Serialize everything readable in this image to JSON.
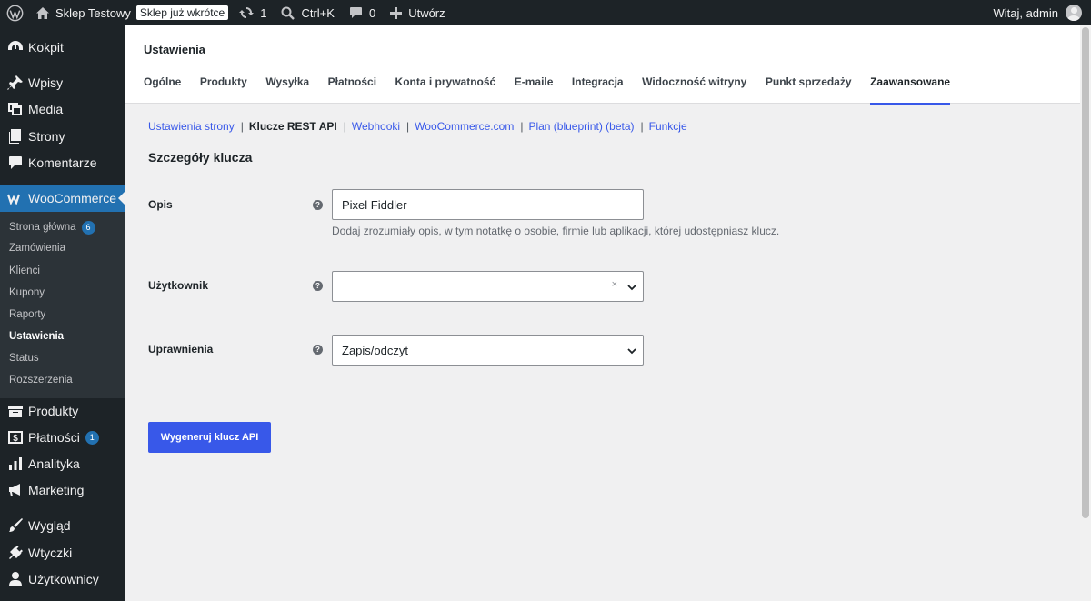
{
  "admin_bar": {
    "site_name": "Sklep Testowy",
    "coming_soon": "Sklep już wkrótce",
    "updates_count": "1",
    "search_shortcut": "Ctrl+K",
    "comments_count": "0",
    "new_label": "Utwórz",
    "greeting": "Witaj, admin"
  },
  "sidebar": {
    "items": [
      {
        "label": "Kokpit",
        "icon": "gauge-icon"
      },
      {
        "label": "Wpisy",
        "icon": "pushpin-icon"
      },
      {
        "label": "Media",
        "icon": "media-icon"
      },
      {
        "label": "Strony",
        "icon": "page-icon"
      },
      {
        "label": "Komentarze",
        "icon": "comment-icon"
      },
      {
        "label": "WooCommerce",
        "icon": "woocommerce-icon"
      },
      {
        "label": "Produkty",
        "icon": "archive-icon"
      },
      {
        "label": "Płatności",
        "icon": "payment-icon",
        "badge": "1"
      },
      {
        "label": "Analityka",
        "icon": "bar-chart-icon"
      },
      {
        "label": "Marketing",
        "icon": "megaphone-icon"
      },
      {
        "label": "Wygląd",
        "icon": "paintbrush-icon"
      },
      {
        "label": "Wtyczki",
        "icon": "plug-icon"
      },
      {
        "label": "Użytkownicy",
        "icon": "users-icon"
      }
    ],
    "submenu": [
      {
        "label": "Strona główna",
        "badge": "6"
      },
      {
        "label": "Zamówienia"
      },
      {
        "label": "Klienci"
      },
      {
        "label": "Kupony"
      },
      {
        "label": "Raporty"
      },
      {
        "label": "Ustawienia"
      },
      {
        "label": "Status"
      },
      {
        "label": "Rozszerzenia"
      }
    ]
  },
  "header": {
    "title": "Ustawienia",
    "tabs": [
      "Ogólne",
      "Produkty",
      "Wysyłka",
      "Płatności",
      "Konta i prywatność",
      "E-maile",
      "Integracja",
      "Widoczność witryny",
      "Punkt sprzedaży",
      "Zaawansowane"
    ],
    "active_tab": "Zaawansowane"
  },
  "subnav": [
    "Ustawienia strony",
    "Klucze REST API",
    "Webhooki",
    "WooCommerce.com",
    "Plan (blueprint) (beta)",
    "Funkcje"
  ],
  "form": {
    "section_title": "Szczegóły klucza",
    "description_label": "Opis",
    "description_value": "Pixel Fiddler",
    "description_help": "Dodaj zrozumiały opis, w tym notatkę o osobie, firmie lub aplikacji, której udostępniasz klucz.",
    "user_label": "Użytkownik",
    "user_value": "",
    "user_clear": "×",
    "permissions_label": "Uprawnienia",
    "permissions_value": "Zapis/odczyt",
    "help_glyph": "?",
    "submit_label": "Wygeneruj klucz API"
  },
  "colors": {
    "accent": "#3858e9",
    "admin_dark": "#1d2327",
    "submenu_bg": "#2c3338",
    "active_menu": "#2271b1"
  }
}
